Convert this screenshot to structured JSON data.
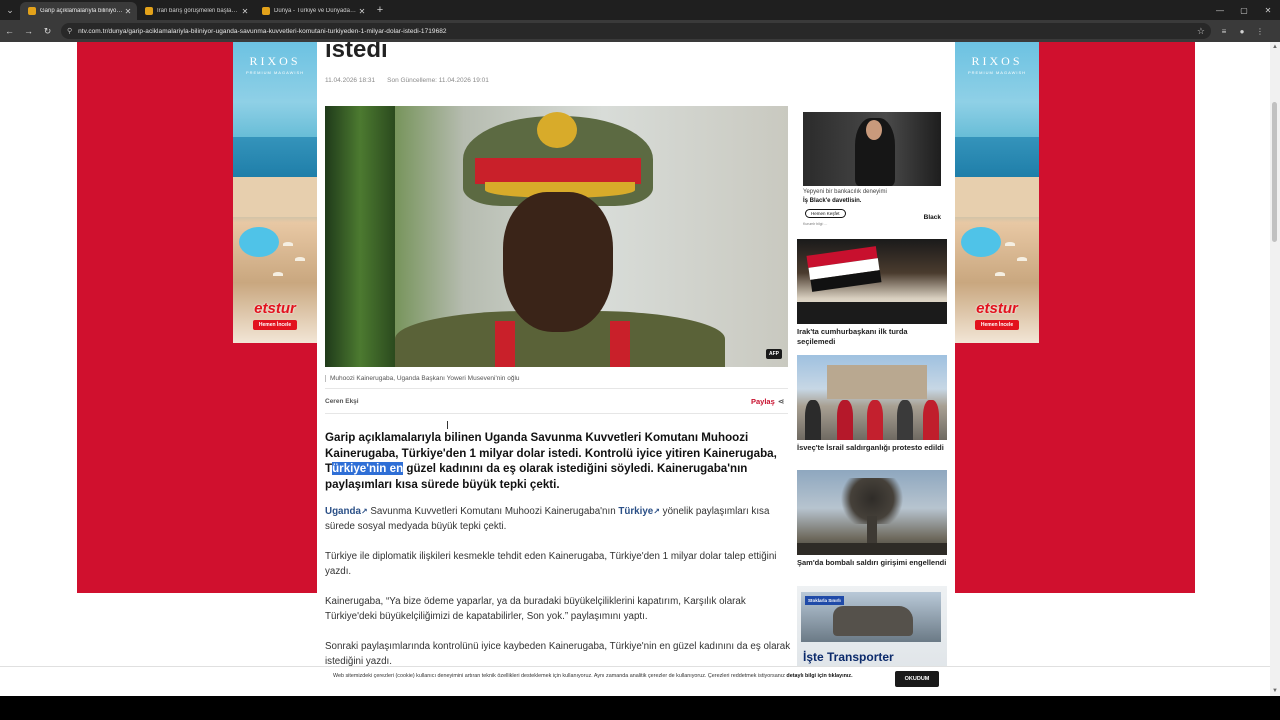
{
  "browser": {
    "tabs": [
      {
        "title": "Garip açıklamalarıyla biliniyor...",
        "favicon_color": "#e3a21a",
        "active": true
      },
      {
        "title": "İran barış görüşmeleri başladı...",
        "favicon_color": "#e3a21a",
        "active": false
      },
      {
        "title": "Dünya - Türkiye ve Dünyadan G...",
        "favicon_color": "#e3a21a",
        "active": false
      }
    ],
    "url": "ntv.com.tr/dunya/garip-aciklamalariyla-biliniyor-uganda-savunma-kuvvetleri-komutani-turkiyeden-1-milyar-dolar-istedi-1719682"
  },
  "article": {
    "headline_tail": "istedi",
    "published": "11.04.2026 18:31",
    "updated": "Son Güncelleme: 11.04.2026 19:01",
    "photo_credit": "AFP",
    "caption": "Muhoozi Kainerugaba, Uganda Başkanı Yoweri Museveni'nin oğlu",
    "author": "Ceren Ekşi",
    "share_label": "Paylaş",
    "lead_before": "Garip açıklamalarıyla bilinen Uganda Savunma Kuvvetleri Komutanı Muhoozi Kainerugaba, Türkiye'den 1 milyar dolar istedi. Kontrolü iyice yitiren Kainerugaba, T",
    "lead_selected": "ürkiye'nin en",
    "lead_after": " güzel kadınını da eş olarak istediğini söyledi. Kainerugaba'nın paylaşımları kısa sürede büyük tepki çekti.",
    "p1_link1": "Uganda",
    "p1_mid": " Savunma Kuvvetleri Komutanı Muhoozi Kainerugaba'nın ",
    "p1_link2": "Türkiye",
    "p1_end": " yönelik paylaşımları kısa sürede sosyal medyada büyük tepki çekti.",
    "p2": "Türkiye ile diplomatik ilişkileri kesmekle tehdit eden Kainerugaba, Türkiye'den 1 milyar dolar talep ettiğini yazdı.",
    "p3": "Kainerugaba, “Ya bize ödeme yaparlar, ya da buradaki büyükelçiliklerini kapatırım, Karşılık olarak Türkiye'deki büyükelçiliğimizi de kapatabilirler, Son yok.” paylaşımını yaptı.",
    "p4": "Sonraki paylaşımlarında kontrolünü iyice kaybeden Kainerugaba, Türkiye'nin en güzel kadınını da eş olarak istediğini yazdı."
  },
  "ads": {
    "skin_brand": "RIXOS",
    "skin_sub": "PREMIUM MAGAWISH",
    "skin_ets": "etstur",
    "skin_cta": "Hemen İncele",
    "bank_line1": "Yepyeni bir bankacılık deneyimi",
    "bank_line2": "İş Black'e davetlisin.",
    "bank_btn": "Hemen Keşfet",
    "bank_small": "Kurumlr bilgi: ...",
    "bank_logo": "Black",
    "van_tag": "Stoklarla Sınırlı",
    "van_title": "İşte Transporter"
  },
  "rail_news": [
    {
      "title": "Irak'ta cumhurbaşkanı ilk turda seçilemedi"
    },
    {
      "title": "İsveç'te İsrail saldırganlığı protesto edildi"
    },
    {
      "title": "Şam'da bombalı saldırı girişimi engellendi"
    }
  ],
  "cookie": {
    "text": "Web sitemizdeki çerezleri (cookie) kullanıcı deneyimini artıran teknik özellikleri desteklemek için kullanıyoruz. Aynı zamanda analitik çerezler de kullanıyoruz. Çerezleri reddetmek istiyorsanız",
    "link": "detaylı bilgi için tıklayınız.",
    "button": "OKUDUM"
  },
  "colors": {
    "brand_red": "#d0102e",
    "link_blue": "#2a4f86",
    "selection_blue": "#2f6fd6"
  }
}
